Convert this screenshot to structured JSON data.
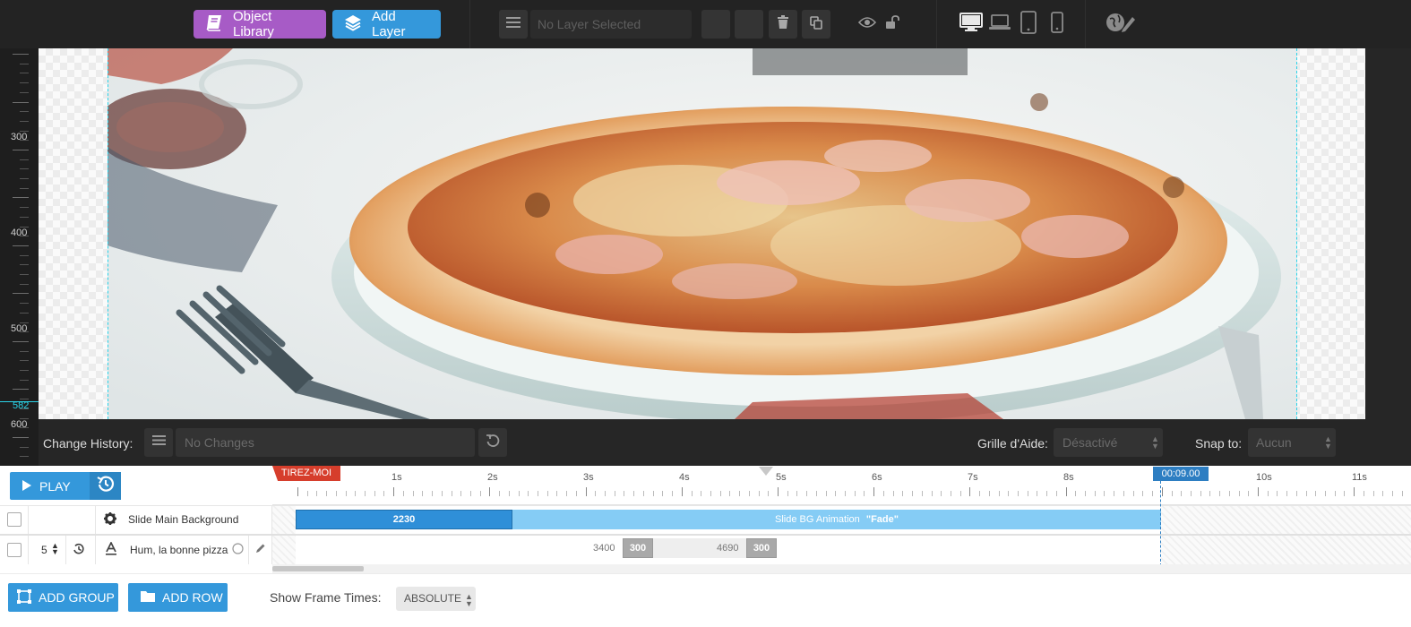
{
  "toolbar": {
    "object_library_label": "Object Library",
    "add_layer_label": "Add Layer",
    "layer_select_value": "No Layer Selected",
    "accent_purple": "#a75bc6",
    "accent_blue": "#3498db"
  },
  "ruler": {
    "labels": [
      "300",
      "400",
      "500",
      "600"
    ],
    "marker_value": "582"
  },
  "history": {
    "label": "Change History:",
    "value": "No Changes",
    "grid_label": "Grille d'Aide:",
    "grid_value": "Désactivé",
    "snap_label": "Snap to:",
    "snap_value": "Aucun"
  },
  "timeline": {
    "play_label": "PLAY",
    "tirez_label": "TIREZ-MOI",
    "end_time": "00:09.00",
    "second_labels": [
      "1s",
      "2s",
      "3s",
      "4s",
      "5s",
      "6s",
      "7s",
      "8s",
      "10s",
      "11s"
    ],
    "row1": {
      "name": "Slide Main Background",
      "bar_value": "2230",
      "anim_label": "Slide BG Animation",
      "anim_name": "\"Fade\""
    },
    "row2": {
      "index": "5",
      "name": "Hum, la bonne pizza",
      "frame1_start": "3400",
      "frame1_duration": "300",
      "frame2_start": "4690",
      "frame2_duration": "300"
    }
  },
  "footer": {
    "add_group_label": "ADD GROUP",
    "add_row_label": "ADD ROW",
    "frame_times_label": "Show Frame Times:",
    "frame_times_value": "ABSOLUTE"
  }
}
